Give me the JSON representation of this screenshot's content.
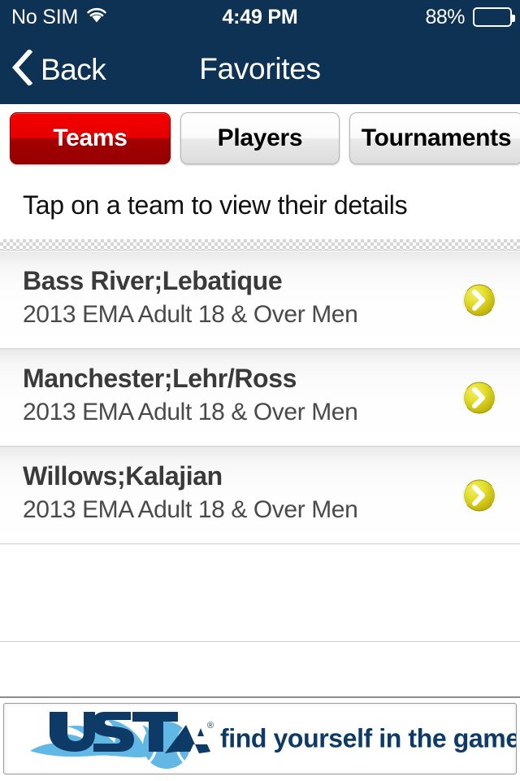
{
  "status_bar": {
    "carrier": "No SIM",
    "wifi_icon": "wifi-icon",
    "time": "4:49 PM",
    "battery_percent": "88%",
    "battery_level": 88,
    "battery_icon": "battery-icon"
  },
  "nav_bar": {
    "back_icon": "chevron-left-icon",
    "back_label": "Back",
    "title": "Favorites",
    "background_color": "#0d3254"
  },
  "tabs": {
    "active_index": 0,
    "items": [
      {
        "label": "Teams",
        "active": true
      },
      {
        "label": "Players",
        "active": false
      },
      {
        "label": "Tournaments",
        "active": false
      }
    ],
    "active_color": "#e60000",
    "inactive_color": "#eaeaea"
  },
  "instruction": {
    "text": "Tap on a team to view their details"
  },
  "list": {
    "rows": [
      {
        "title": "Bass River;Lebatique",
        "subtitle": "2013 EMA Adult 18 & Over Men",
        "accessory_icon": "tennis-ball-chevron-icon"
      },
      {
        "title": "Manchester;Lehr/Ross",
        "subtitle": "2013 EMA Adult 18 & Over Men",
        "accessory_icon": "tennis-ball-chevron-icon"
      },
      {
        "title": "Willows;Kalajian",
        "subtitle": "2013 EMA Adult 18 & Over Men",
        "accessory_icon": "tennis-ball-chevron-icon"
      }
    ],
    "empty_row_count": 2
  },
  "ad_banner": {
    "logo_text": "USTA",
    "logo_registered_mark": "®",
    "tagline": "find yourself in the game",
    "logo_name": "usta-logo",
    "brand_navy": "#0d3a66",
    "brand_blue": "#62b8e4"
  }
}
